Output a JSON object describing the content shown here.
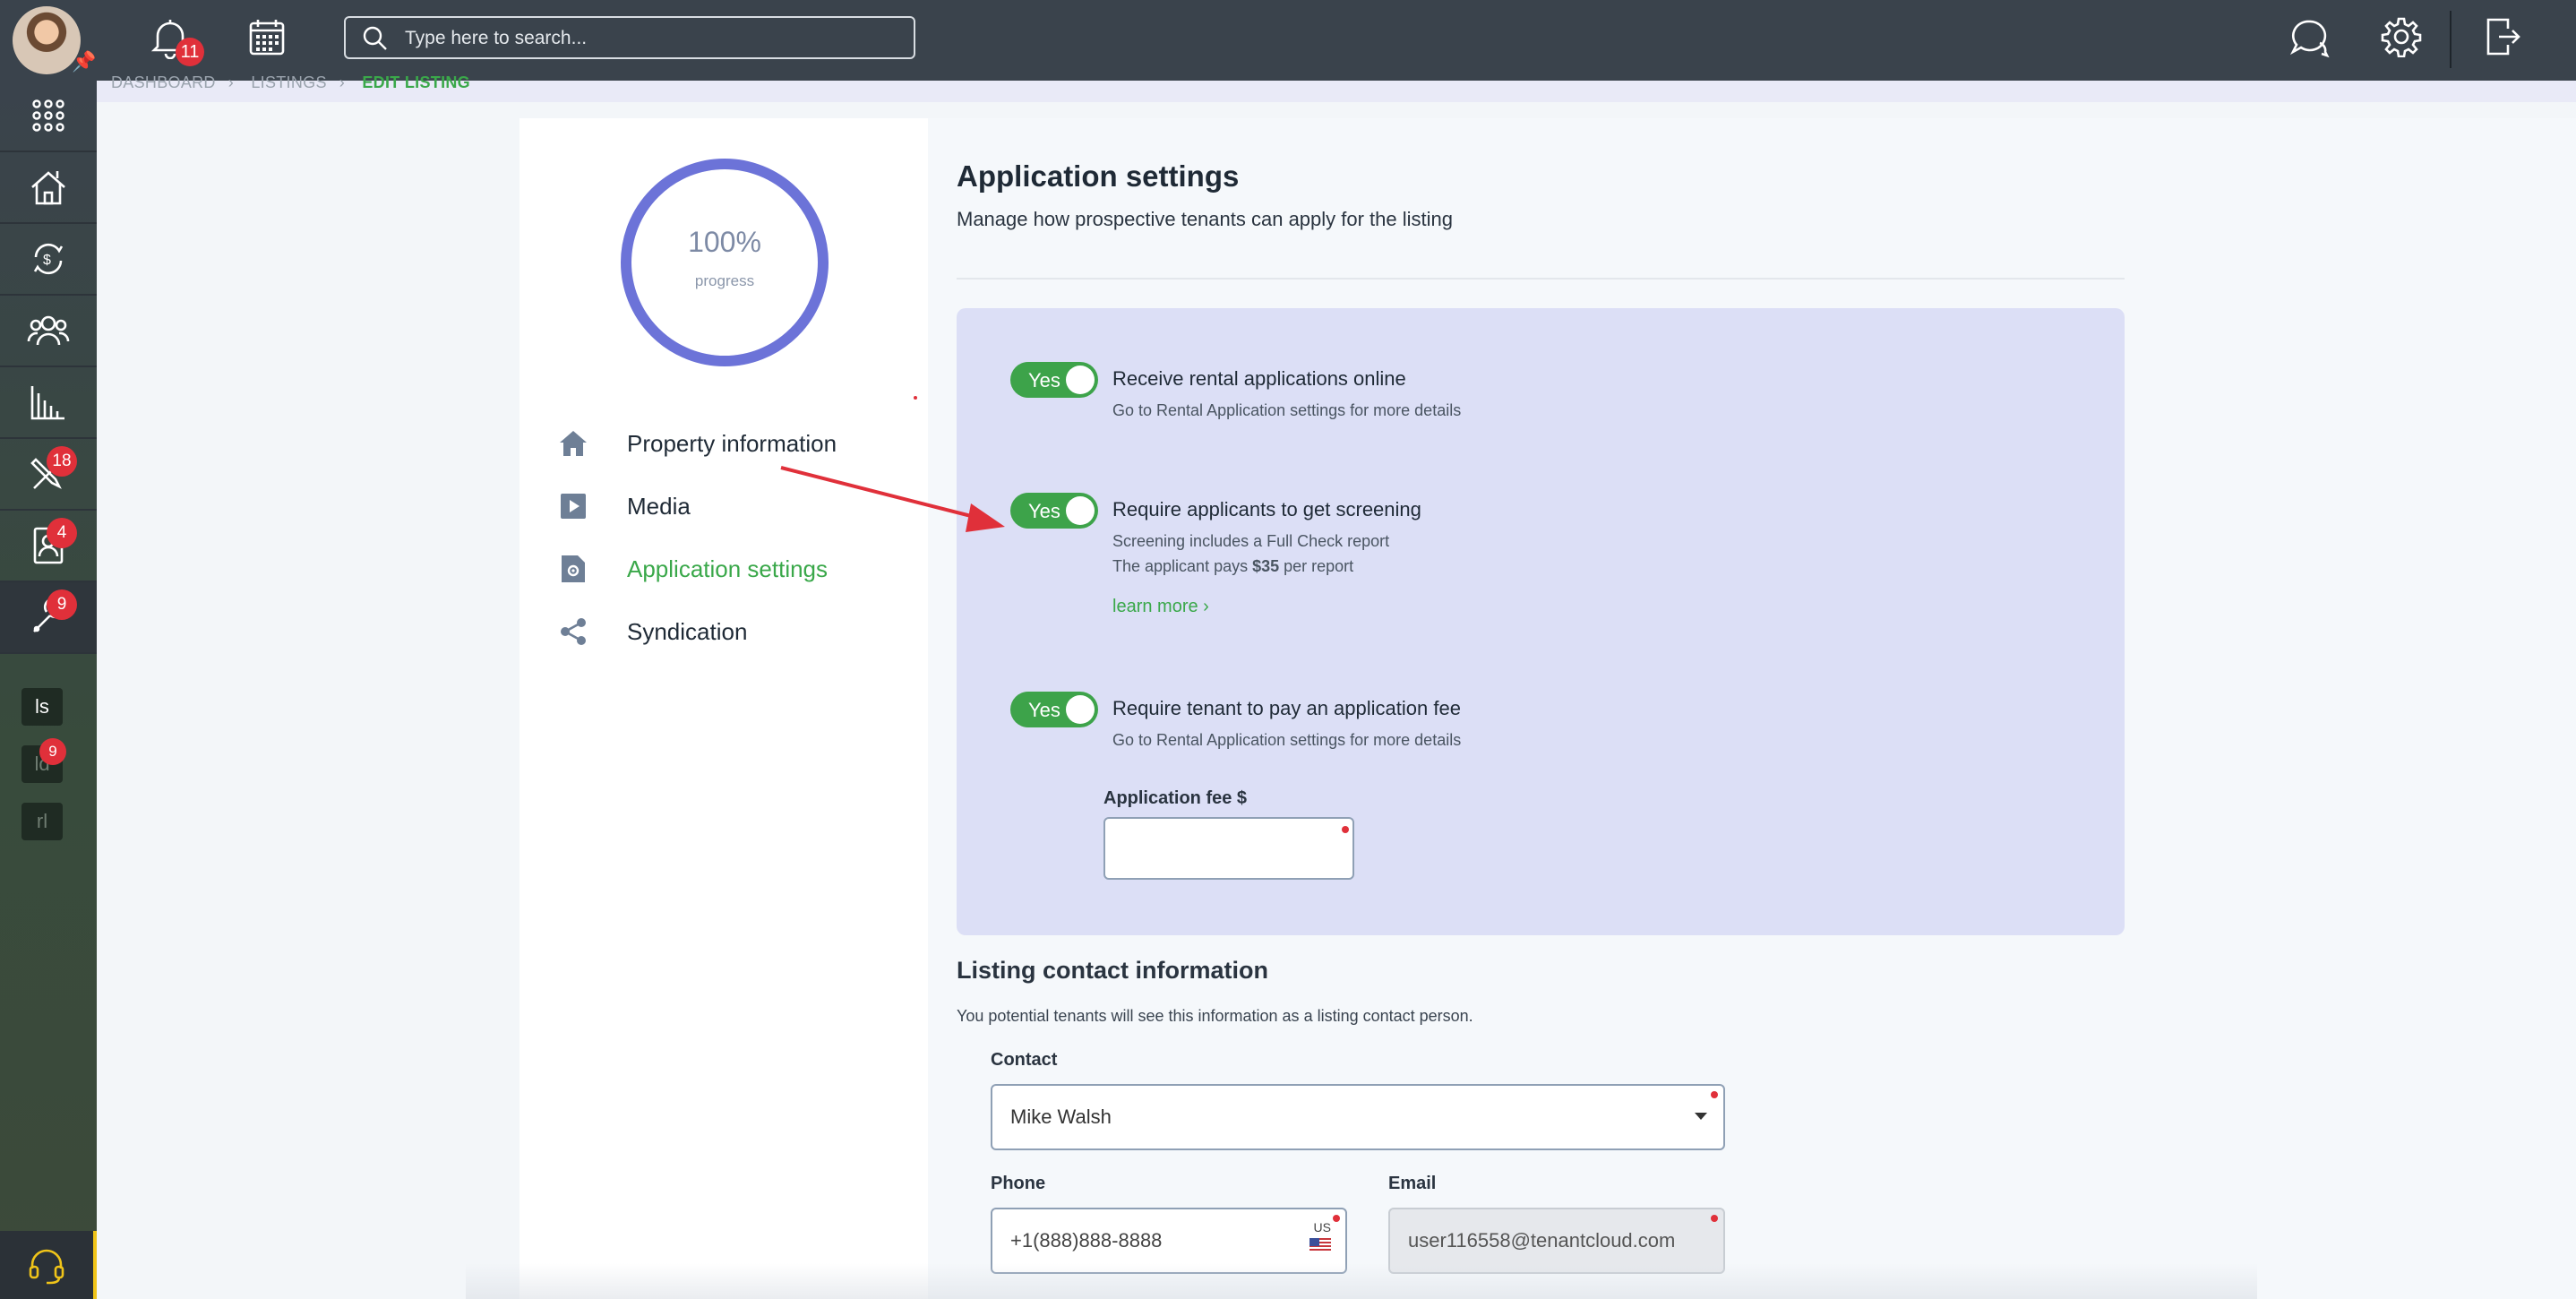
{
  "topbar": {
    "notifications_count": "11",
    "search": {
      "placeholder": "Type here to search..."
    }
  },
  "sidebar": {
    "badges": {
      "maintenance": "18",
      "contacts": "4",
      "tools": "9",
      "mini_ld": "9"
    },
    "mini_items": [
      "ls",
      "ld",
      "rl"
    ]
  },
  "breadcrumb": {
    "items": [
      "DASHBOARD",
      "LISTINGS",
      "EDIT LISTING"
    ]
  },
  "progress": {
    "value": "100%",
    "label": "progress",
    "fraction": 1.0
  },
  "nav": {
    "items": [
      {
        "label": "Property information"
      },
      {
        "label": "Media"
      },
      {
        "label": "Application settings"
      },
      {
        "label": "Syndication"
      }
    ]
  },
  "settings": {
    "title": "Application settings",
    "subtitle": "Manage how prospective tenants can apply for the listing",
    "options": [
      {
        "toggle": "Yes",
        "title": "Receive rental applications online",
        "note": "Go to Rental Application settings for more details"
      },
      {
        "toggle": "Yes",
        "title": "Require applicants to get screening",
        "note1": "Screening includes a Full Check report",
        "note2_pre": "The applicant pays ",
        "note2_bold": "$35",
        "note2_post": " per report",
        "link": "learn more ›"
      },
      {
        "toggle": "Yes",
        "title": "Require tenant to pay an application fee",
        "note": "Go to Rental Application settings for more details"
      }
    ],
    "fee_label": "Application fee $",
    "fee_value": ""
  },
  "contact": {
    "title": "Listing contact information",
    "subtitle": "You potential tenants will see this information as a listing contact person.",
    "contact_label": "Contact",
    "contact_value": "Mike Walsh",
    "phone_label": "Phone",
    "phone_value": "+1(888)888-8888",
    "phone_country": "US",
    "email_label": "Email",
    "email_value": "user116558@tenantcloud.com"
  },
  "colors": {
    "accent_green": "#3aa84a",
    "topbar": "#3a434c",
    "ring": "#6c73d8",
    "panel": "#dcdff6",
    "badge_red": "#e0303a"
  }
}
